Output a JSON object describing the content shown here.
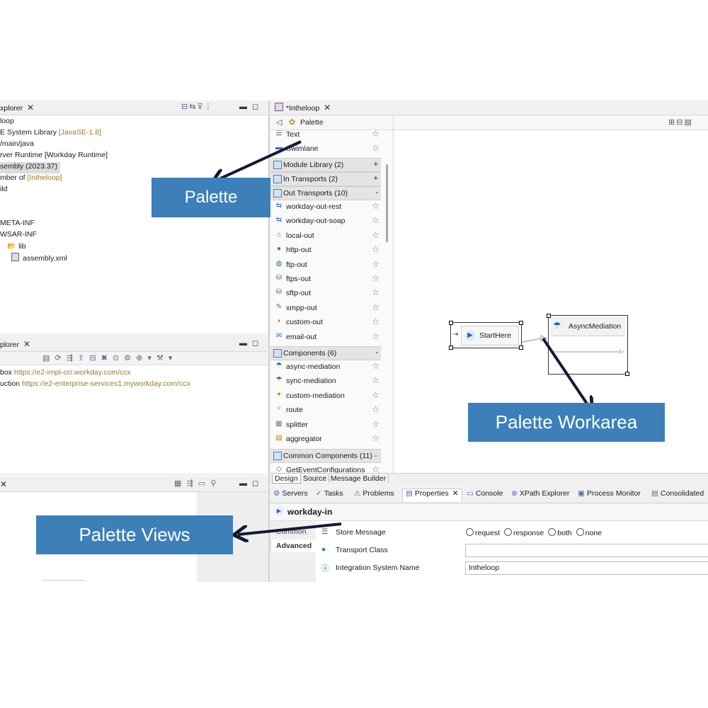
{
  "project_explorer": {
    "tab_title": "xplorer",
    "items": [
      {
        "text": "loop",
        "dec": ""
      },
      {
        "text": "E System Library ",
        "dec": "[JavaSE-1.8]"
      },
      {
        "text": "/main/java",
        "dec": ""
      },
      {
        "text": "rver Runtime [Workday Runtime]",
        "dec": ""
      },
      {
        "text": "sembly (2023.37)",
        "dec": ""
      },
      {
        "text": "mber of  ",
        "dec": "[Intheloop]"
      },
      {
        "text": "ild",
        "dec": ""
      },
      {
        "text": "",
        "dec": ""
      },
      {
        "text": "",
        "dec": ""
      },
      {
        "text": "META-INF",
        "dec": ""
      },
      {
        "text": "WSAR-INF",
        "dec": ""
      },
      {
        "text": "lib",
        "dec": ""
      },
      {
        "text": "assembly.xml",
        "dec": ""
      }
    ]
  },
  "server_explorer": {
    "tab_title": "plorer",
    "rows": [
      {
        "name": "box ",
        "url": "https://e2-impl-cci.workday.com/ccx"
      },
      {
        "name": "uction ",
        "url": "https://e2-enterprise-services1.myworkday.com/ccx"
      }
    ]
  },
  "editor": {
    "tab_title": "*Intheloop",
    "palette_label": "Palette",
    "palette_top_items": [
      "Text",
      "Swimlane"
    ],
    "categories": [
      {
        "label": "Module Library (2)",
        "toggle": "+"
      },
      {
        "label": "In Transports (2)",
        "toggle": "+"
      }
    ],
    "out_transports_label": "Out Transports (10)",
    "out_transports_toggle": "-",
    "out_transports": [
      "workday-out-rest",
      "workday-out-soap",
      "local-out",
      "http-out",
      "ftp-out",
      "ftps-out",
      "sftp-out",
      "xmpp-out",
      "custom-out",
      "email-out"
    ],
    "components_label": "Components (6)",
    "components_toggle": "-",
    "components": [
      "async-mediation",
      "sync-mediation",
      "custom-mediation",
      "route",
      "splitter",
      "aggregator"
    ],
    "common_components_label": "Common Components (11) -",
    "common_partial": "GetEventConfigurations",
    "bottom_tabs": [
      "Design",
      "Source",
      "Message Builder"
    ],
    "canvas": {
      "start_label": "StartHere",
      "async_label": "AsyncMediation"
    }
  },
  "views": {
    "tabs": [
      "Servers",
      "Tasks",
      "Problems",
      "Properties",
      "Console",
      "XPath Explorer",
      "Process Monitor",
      "Consolidated"
    ],
    "properties_title": "workday-in",
    "side_tabs": [
      "Common",
      "Advanced"
    ],
    "rows": [
      {
        "label": "Store Message",
        "value": ""
      },
      {
        "label": "Transport Class",
        "value": ""
      },
      {
        "label": "Integration System Name",
        "value": "Intheloop"
      }
    ],
    "radio_options": [
      "request",
      "response",
      "both",
      "none"
    ]
  },
  "callouts": {
    "palette": "Palette",
    "palette_workarea": "Palette Workarea",
    "palette_views": "Palette Views"
  },
  "colors": {
    "callout_bg": "#3d7fb9",
    "arrow": "#111a33",
    "selection": "#cde3f7"
  }
}
